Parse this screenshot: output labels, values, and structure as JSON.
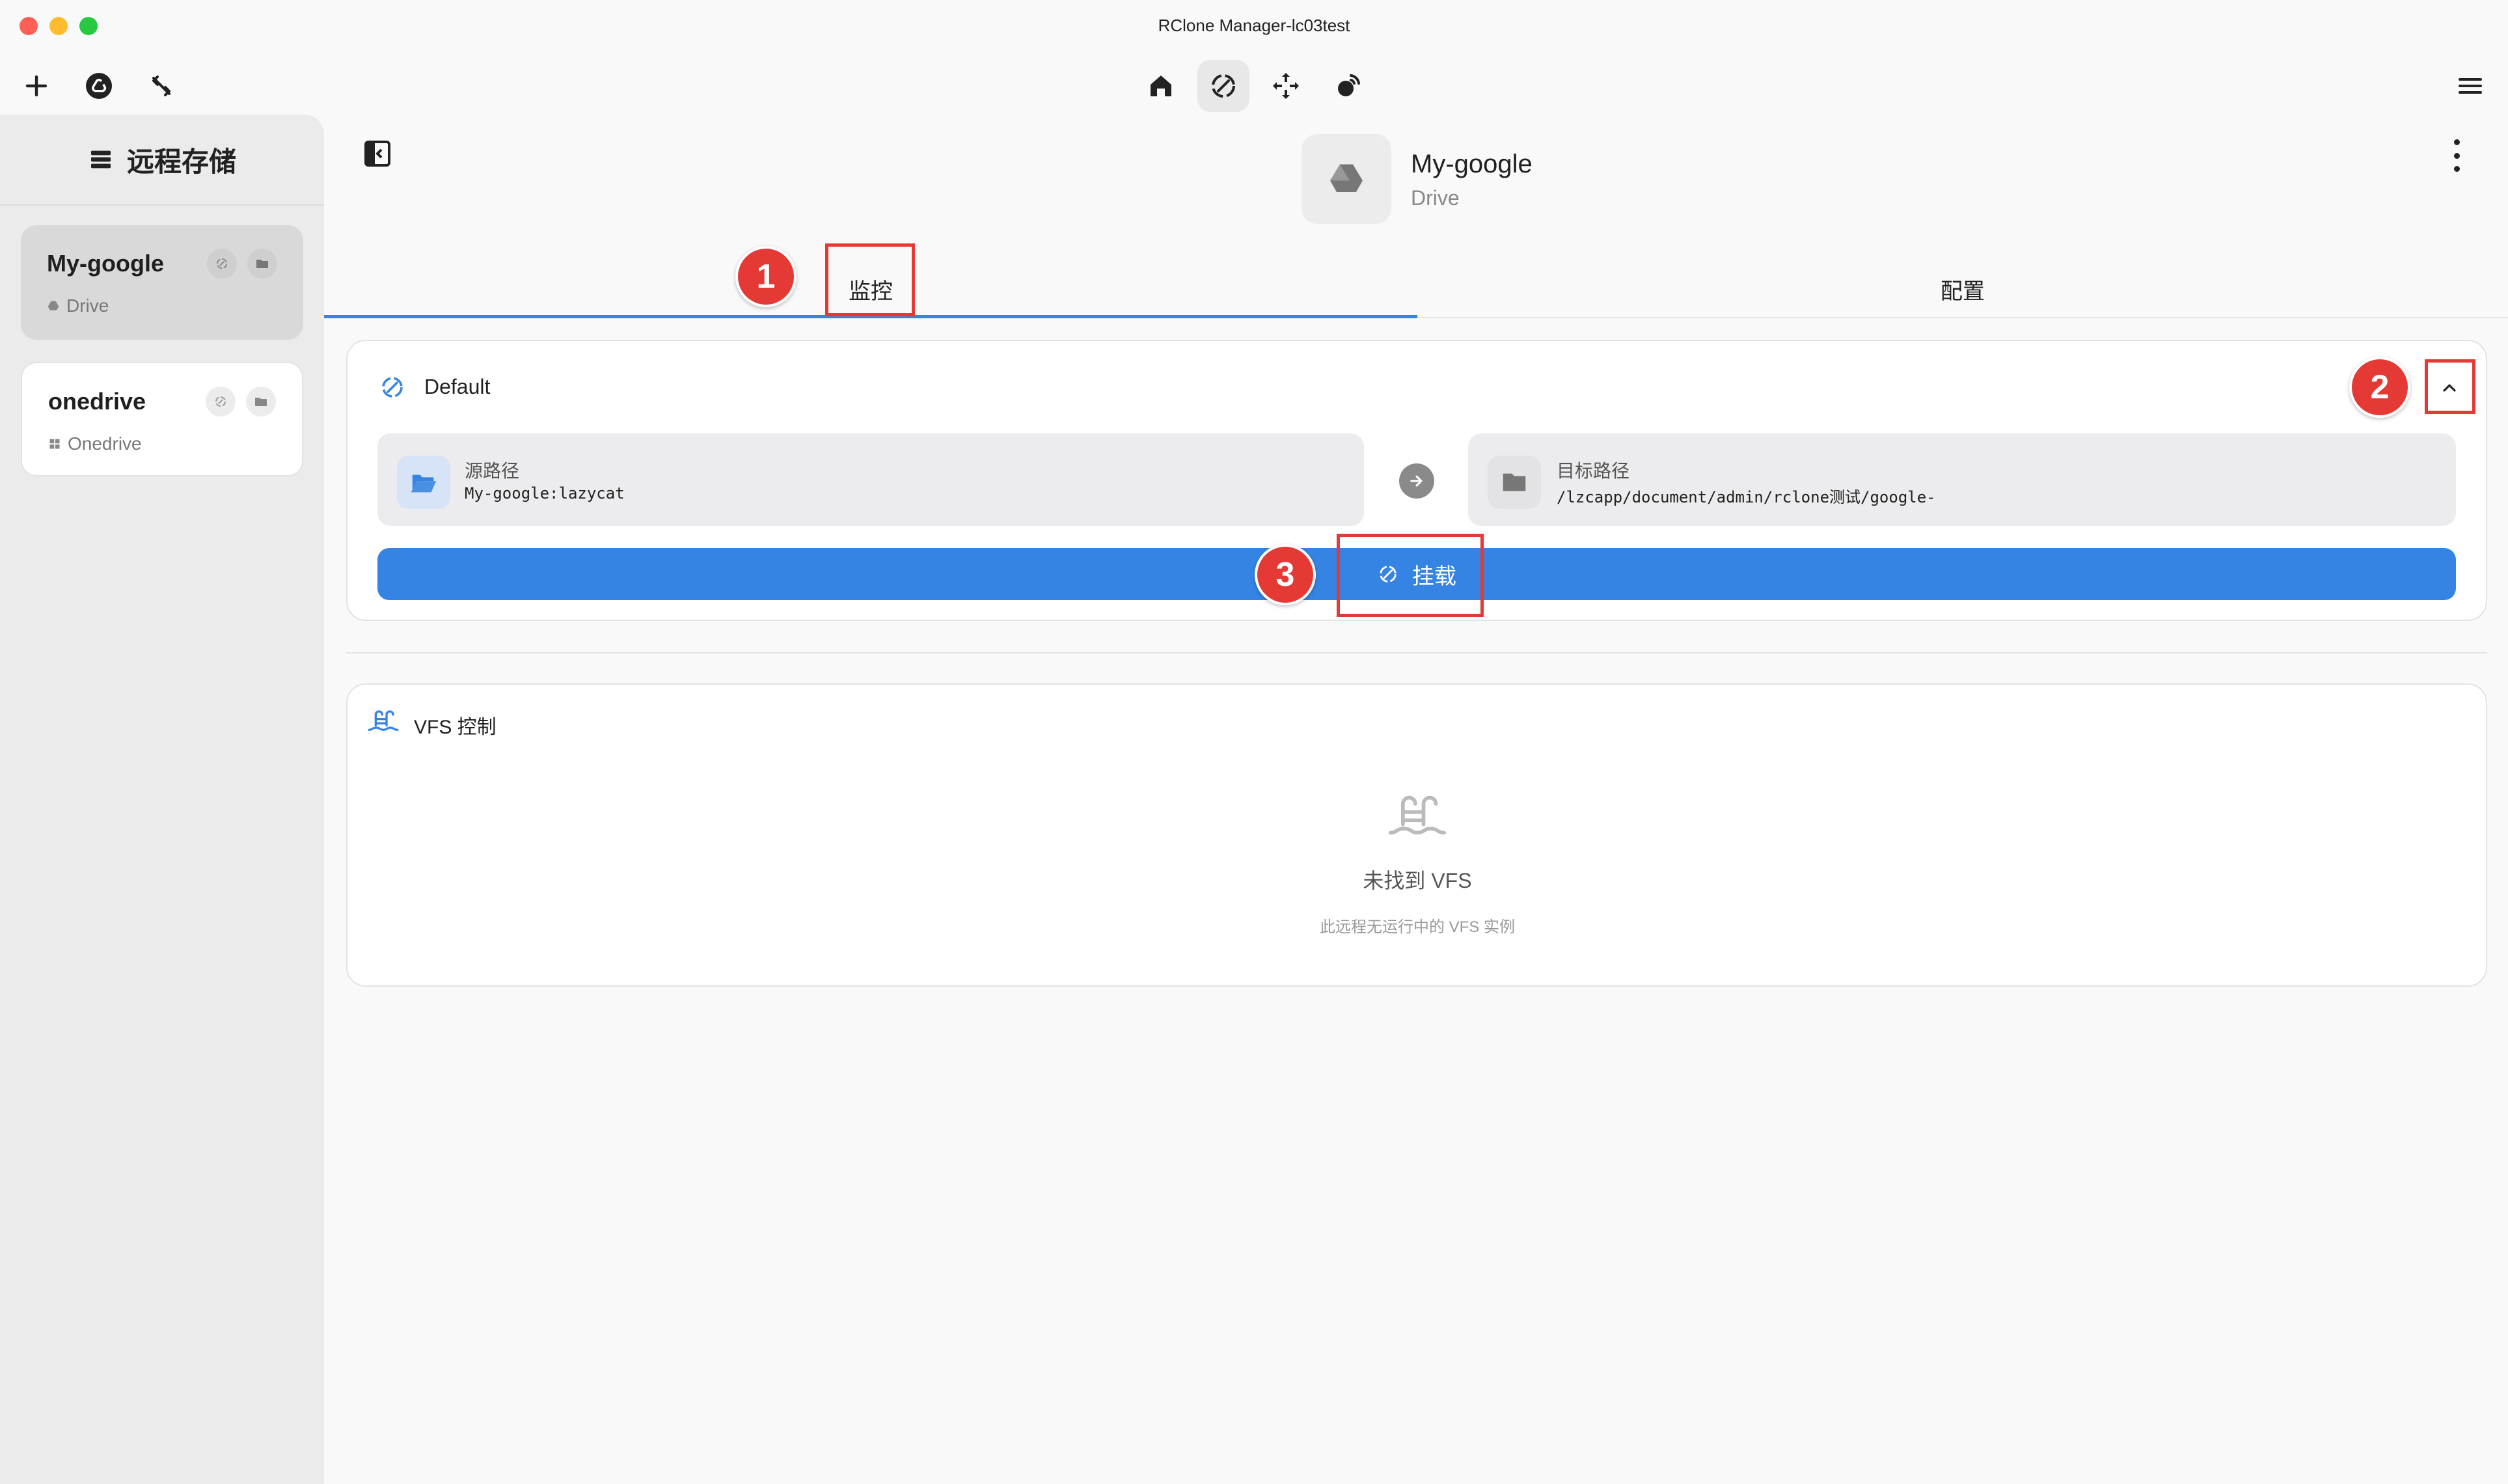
{
  "window": {
    "title": "RClone Manager-lc03test"
  },
  "toolbar": {
    "left_icons": [
      "plus-icon",
      "rclone-logo-icon",
      "disconnect-icon"
    ],
    "center_icons": [
      "home-icon",
      "mount-icon",
      "sync-icon",
      "serve-icon"
    ],
    "active_center": "mount-icon",
    "right_icons": [
      "menu-icon"
    ]
  },
  "sidebar": {
    "title": "远程存储",
    "remotes": [
      {
        "name": "My-google",
        "type": "Drive",
        "selected": true
      },
      {
        "name": "onedrive",
        "type": "Onedrive",
        "selected": false
      }
    ]
  },
  "remote_header": {
    "name": "My-google",
    "type": "Drive"
  },
  "tabs": {
    "monitor": "监控",
    "config": "配置",
    "active": "monitor"
  },
  "mount_card": {
    "title": "Default",
    "source_label": "源路径",
    "source_value": "My-google:lazycat",
    "dest_label": "目标路径",
    "dest_value": "/lzcapp/document/admin/rclone测试/google-",
    "mount_button_label": "挂载"
  },
  "vfs_card": {
    "title": "VFS 控制",
    "empty_title": "未找到 VFS",
    "empty_subtitle": "此远程无运行中的 VFS 实例"
  },
  "annotations": [
    "1",
    "2",
    "3"
  ],
  "colors": {
    "accent": "#3584e4",
    "annotation": "#e53935",
    "sidebar_bg": "#ebebeb"
  }
}
